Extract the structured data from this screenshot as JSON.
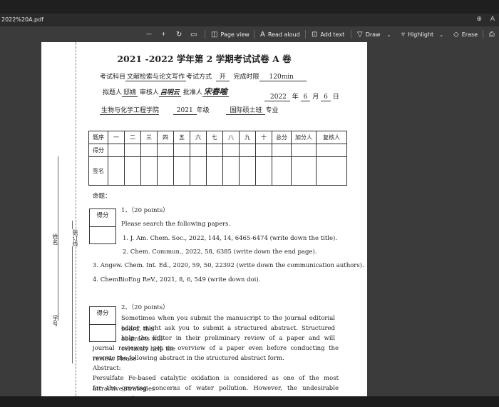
{
  "window": {
    "tab_title": "2022%20A.pdf"
  },
  "tab_icons": {
    "zoom": "zoom-icon",
    "read": "read-aloud-icon"
  },
  "toolbar": {
    "minus": "—",
    "plus": "+",
    "rotate": "rotate-icon",
    "fit": "fit-page-icon",
    "page_view": "Page view",
    "read_aloud": "Read aloud",
    "add_text": "Add text",
    "draw": "Draw",
    "highlight": "Highlight",
    "erase": "Erase"
  },
  "document": {
    "title": "2021 -2022 学年第 2 学期考试试卷 A 卷",
    "course_prefix": "考试科目",
    "course": "文献检索与论文写作",
    "exam_mode_prefix": "考试方式",
    "exam_mode": "开",
    "time_prefix": "完成时限",
    "time": "120min",
    "author_prefix": "拟题人",
    "author": "邸婧",
    "reviewer_prefix": "审核人",
    "reviewer": "吕明云",
    "approver_prefix": "批准人",
    "approver": "宋春喻",
    "date_year": "2022",
    "date_year_unit": "年",
    "date_month": "6",
    "date_month_unit": "月",
    "date_day": "6",
    "date_day_unit": "日",
    "college": "生物与化学工程学院",
    "grade": "2021",
    "grade_unit": "年级",
    "major": "国际硕士班",
    "major_unit": "专业",
    "table": {
      "headers": [
        "题序",
        "一",
        "二",
        "三",
        "四",
        "五",
        "六",
        "七",
        "八",
        "九",
        "十",
        "总分",
        "加分人",
        "复核人"
      ],
      "row_score": "得分",
      "row_sign": "签名"
    },
    "ming_ti": "命题：",
    "q1": {
      "score_label": "得分",
      "head": "1、（20 points）",
      "intro": "Please search the following papers.",
      "items": [
        "1.   J. Am. Chem. Soc., 2022, 144, 14, 6465-6474 (write down the title).",
        "2.   Chem. Commun., 2022, 58, 6385 (write down the end page).",
        "3.   Angew. Chem. Int. Ed., 2020, 59, 50, 22392 (write down the communication authors).",
        "4.   ChemBioEng ReV., 2021, 8, 6, 549 (write down doi)."
      ]
    },
    "q2": {
      "score_label": "得分",
      "head": "2、（20 points）",
      "lines": [
        "Sometimes when you submit the manuscript to the journal editorial board, the",
        "editor might ask you to submit a structured abstract. Structured abstracts will",
        "help the Editor in their preliminary review of a paper and will certainly help the",
        "journal reviewers get an overview of a paper even before conducting the review. Please",
        "rewrite the following abstract in the structured abstract form."
      ],
      "abstract_label": "Abstract:",
      "abstract_lines": [
        "Persulfate Fe-based catalytic oxidation is considered as one of the most attractive strategies",
        "for the growing concerns of water pollution. However, the undesirable FeIII/FeII redox"
      ]
    },
    "margin": {
      "name": "姓名",
      "line": "装订线",
      "student_id": "学号"
    }
  }
}
